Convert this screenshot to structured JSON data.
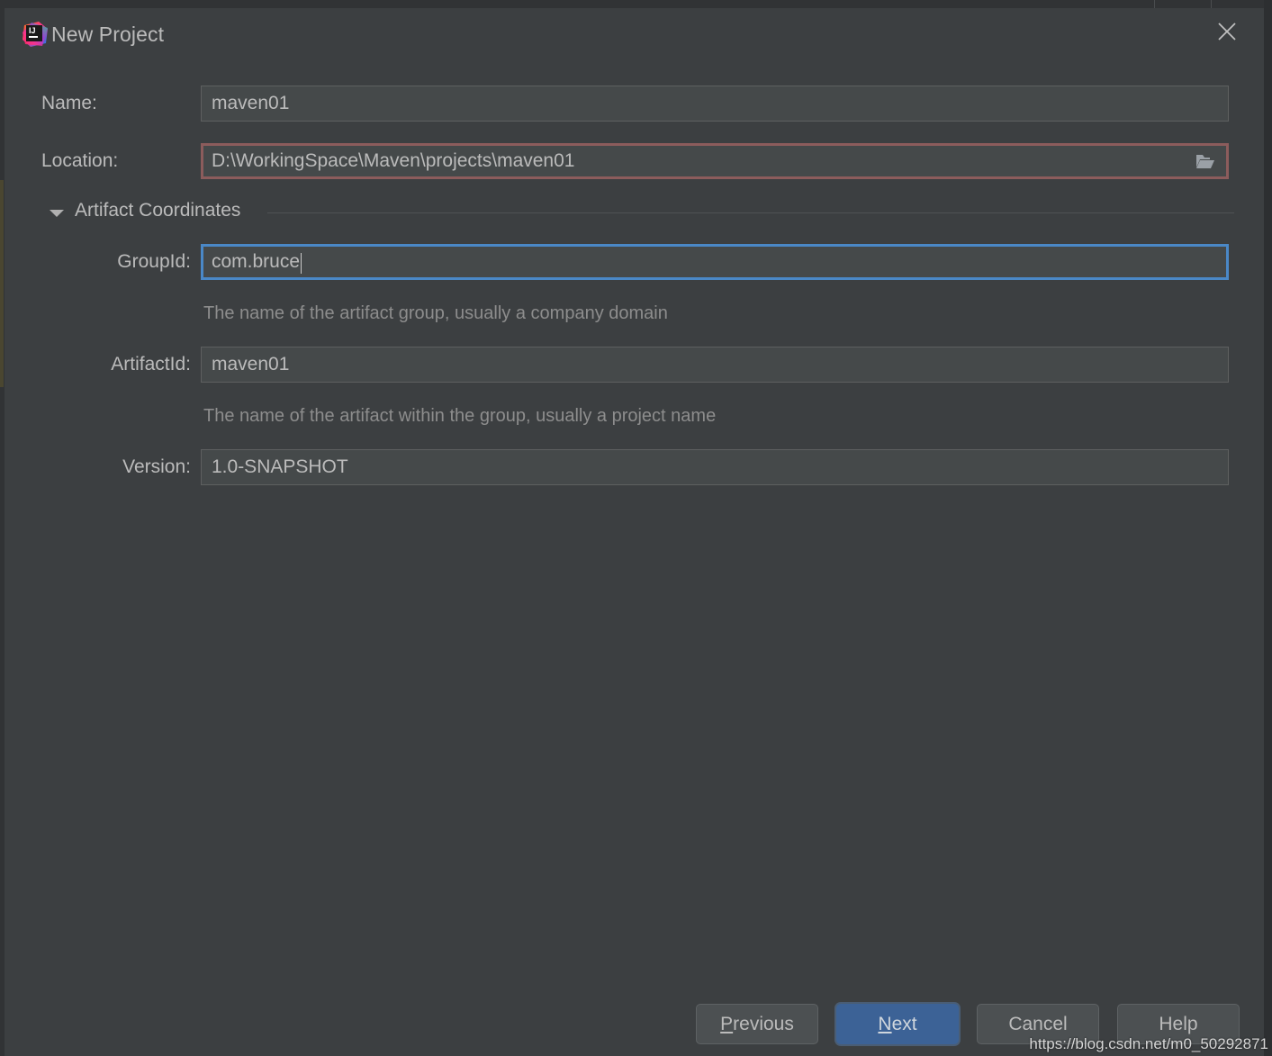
{
  "window": {
    "title": "New Project",
    "app_icon": "intellij-idea-logo",
    "close_icon": "close-icon"
  },
  "form": {
    "name": {
      "label": "Name:",
      "value": "maven01",
      "placeholder": ""
    },
    "location": {
      "label": "Location:",
      "value": "D:\\WorkingSpace\\Maven\\projects\\maven01",
      "placeholder": "",
      "browse_icon": "folder-open-icon",
      "state": "error"
    },
    "section": {
      "label": "Artifact Coordinates",
      "expanded": true,
      "toggle_icon": "chevron-down-icon"
    },
    "group_id": {
      "label": "GroupId:",
      "value": "com.bruce",
      "placeholder": "",
      "hint": "The name of the artifact group, usually a company domain",
      "state": "focused"
    },
    "artifact_id": {
      "label": "ArtifactId:",
      "value": "maven01",
      "placeholder": "",
      "hint": "The name of the artifact within the group, usually a project name"
    },
    "version": {
      "label": "Version:",
      "value": "1.0-SNAPSHOT",
      "placeholder": ""
    }
  },
  "buttons": {
    "previous": {
      "label": "Previous",
      "mnemonic": "P",
      "rest": "revious"
    },
    "next": {
      "label": "Next",
      "mnemonic": "N",
      "rest": "ext",
      "primary": true
    },
    "cancel": {
      "label": "Cancel"
    },
    "help": {
      "label": "Help"
    }
  },
  "watermark": {
    "text": "https://blog.csdn.net/m0_50292871"
  },
  "colors": {
    "dialog_bg": "#3c3f41",
    "input_bg": "#45494a",
    "text": "#bbbbbb",
    "hint_text": "#8d8d8d",
    "error_border": "#8c5c5c",
    "focus_border": "#4a88c7",
    "primary_button": "#3c6296"
  }
}
